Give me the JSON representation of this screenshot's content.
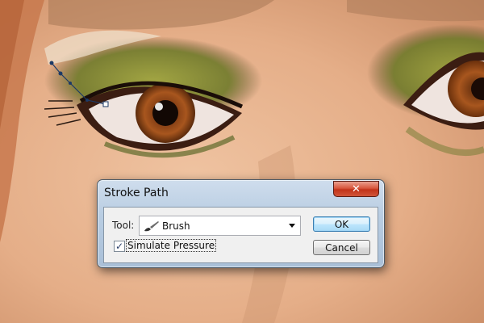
{
  "dialog": {
    "title": "Stroke Path",
    "tool_label": "Tool:",
    "tool_value": "Brush",
    "tool_icon": "brush-icon",
    "simulate_pressure_label": "Simulate Pressure",
    "simulate_pressure_checked": true,
    "ok_label": "OK",
    "cancel_label": "Cancel",
    "close_symbol": "✕"
  },
  "colors": {
    "skin": "#e8b48e",
    "eyeshadow": "#6f7a2a",
    "iris": "#9a4a1a",
    "dialog_frame": "#b9cde2",
    "close_button": "#c2331a"
  }
}
